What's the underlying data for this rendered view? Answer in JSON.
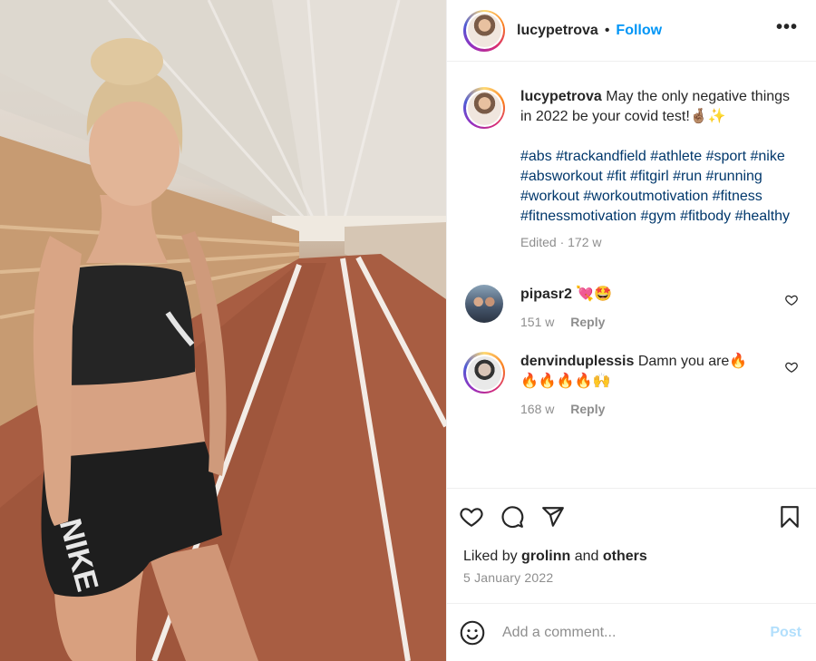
{
  "header": {
    "username": "lucypetrova",
    "separator": "•",
    "follow_label": "Follow",
    "more_label": "•••"
  },
  "caption": {
    "username": "lucypetrova",
    "text": "May the only negative things in 2022 be your covid test!🤞🏽✨",
    "hashtags": "#abs #trackandfield #athlete #sport #nike #absworkout #fit #fitgirl #run #running #workout #workoutmotivation #fitness #fitnessmotivation #gym #fitbody #healthy",
    "meta": "Edited · 172 w"
  },
  "comments": [
    {
      "username": "pipasr2",
      "text": "💘🤩",
      "age": "151 w",
      "reply_label": "Reply"
    },
    {
      "username": "denvinduplessis",
      "text": "Damn you are🔥🔥🔥🔥🔥🙌",
      "age": "168 w",
      "reply_label": "Reply"
    }
  ],
  "actions": {
    "icons": [
      "heart-icon",
      "comment-icon",
      "share-icon",
      "bookmark-icon"
    ]
  },
  "likes": {
    "prefix": "Liked by",
    "user": "grolinn",
    "conj": "and",
    "others": "others",
    "date": "5 January 2022"
  },
  "add_comment": {
    "placeholder": "Add a comment...",
    "post_label": "Post"
  },
  "colors": {
    "link": "#00376b",
    "follow": "#0095f6",
    "post_disabled": "#b2dffc",
    "muted": "#8e8e8e"
  }
}
